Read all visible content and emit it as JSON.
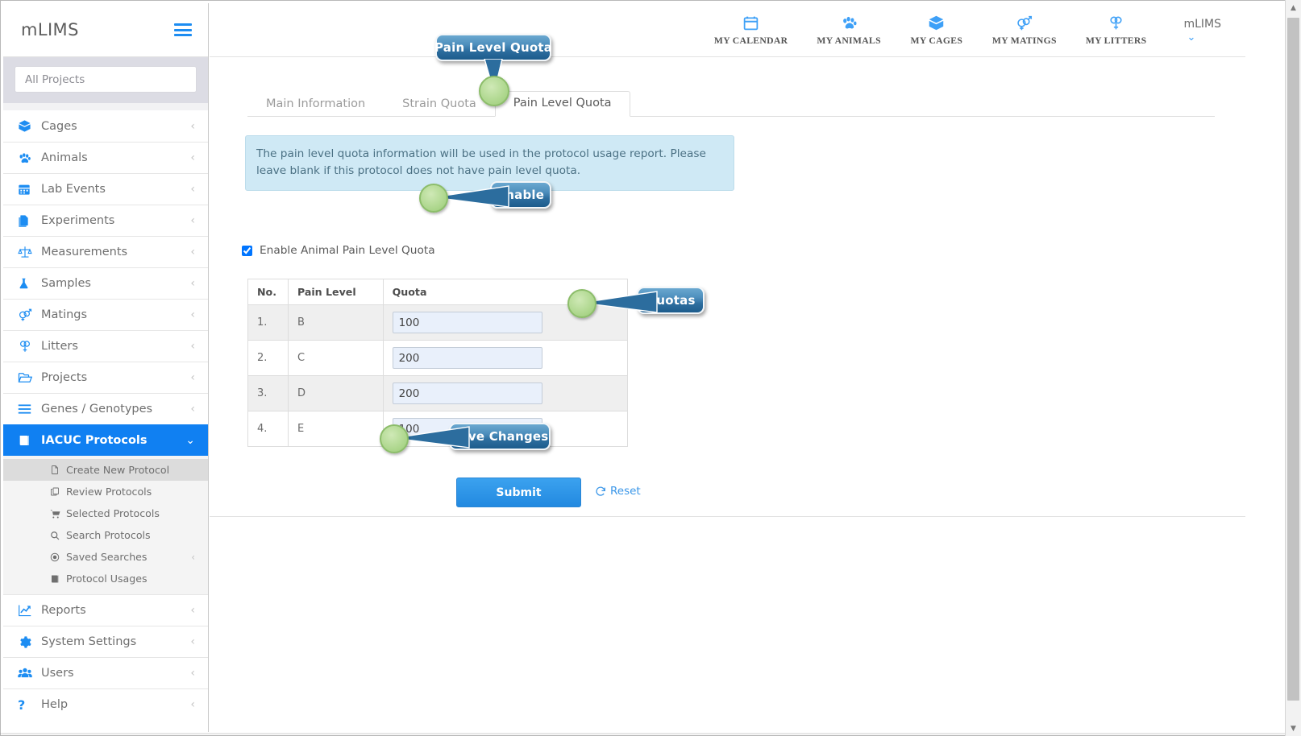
{
  "app": {
    "brand": "mLIMS",
    "menu_icon": "hamburger-icon"
  },
  "sidebar": {
    "project_selector": {
      "placeholder": "All Projects",
      "value": ""
    },
    "items": [
      {
        "label": "Cages",
        "icon": "box-icon",
        "chevron": "‹",
        "active": false
      },
      {
        "label": "Animals",
        "icon": "paw-icon",
        "chevron": "‹",
        "active": false
      },
      {
        "label": "Lab Events",
        "icon": "calendar-icon",
        "chevron": "‹",
        "active": false
      },
      {
        "label": "Experiments",
        "icon": "documents-icon",
        "chevron": "‹",
        "active": false
      },
      {
        "label": "Measurements",
        "icon": "scales-icon",
        "chevron": "‹",
        "active": false
      },
      {
        "label": "Samples",
        "icon": "flask-icon",
        "chevron": "‹",
        "active": false
      },
      {
        "label": "Matings",
        "icon": "mating-icon",
        "chevron": "‹",
        "active": false
      },
      {
        "label": "Litters",
        "icon": "litters-icon",
        "chevron": "‹",
        "active": false
      },
      {
        "label": "Projects",
        "icon": "folder-icon",
        "chevron": "‹",
        "active": false
      },
      {
        "label": "Genes / Genotypes",
        "icon": "list-icon",
        "chevron": "‹",
        "active": false
      },
      {
        "label": "IACUC Protocols",
        "icon": "book-icon",
        "chevron": "⌄",
        "active": true
      }
    ],
    "subitems": [
      {
        "label": "Create New Protocol",
        "icon": "file-icon",
        "selected": true,
        "chevron": ""
      },
      {
        "label": "Review Protocols",
        "icon": "copy-icon",
        "selected": false,
        "chevron": ""
      },
      {
        "label": "Selected Protocols",
        "icon": "cart-icon",
        "selected": false,
        "chevron": ""
      },
      {
        "label": "Search Protocols",
        "icon": "search-icon",
        "selected": false,
        "chevron": ""
      },
      {
        "label": "Saved Searches",
        "icon": "target-icon",
        "selected": false,
        "chevron": "‹"
      },
      {
        "label": "Protocol Usages",
        "icon": "book-icon",
        "selected": false,
        "chevron": ""
      }
    ],
    "items_bottom": [
      {
        "label": "Reports",
        "icon": "chart-icon",
        "chevron": "‹"
      },
      {
        "label": "System Settings",
        "icon": "gear-icon",
        "chevron": "‹"
      },
      {
        "label": "Users",
        "icon": "users-icon",
        "chevron": "‹"
      },
      {
        "label": "Help",
        "icon": "question-icon",
        "chevron": "‹"
      }
    ]
  },
  "topnav": {
    "items": [
      {
        "label": "MY CALENDAR",
        "icon": "calendar-icon"
      },
      {
        "label": "MY ANIMALS",
        "icon": "paw-icon"
      },
      {
        "label": "MY CAGES",
        "icon": "box-icon"
      },
      {
        "label": "MY MATINGS",
        "icon": "mating-icon"
      },
      {
        "label": "MY LITTERS",
        "icon": "litters-icon"
      }
    ],
    "user": {
      "name": "mLIMS",
      "caret": "⌄"
    }
  },
  "main": {
    "tabs": [
      {
        "label": "Main Information",
        "active": false
      },
      {
        "label": "Strain Quota",
        "active": false
      },
      {
        "label": "Pain Level Quota",
        "active": true
      }
    ],
    "info_message": "The pain level quota information will be used in the protocol usage report. Please leave blank if this protocol does not have pain level quota.",
    "enable_checkbox": {
      "label": "Enable Animal Pain Level Quota",
      "checked": true
    },
    "table": {
      "headers": [
        "No.",
        "Pain Level",
        "Quota"
      ],
      "rows": [
        {
          "no": "1.",
          "pain_level": "B",
          "quota": "100"
        },
        {
          "no": "2.",
          "pain_level": "C",
          "quota": "200"
        },
        {
          "no": "3.",
          "pain_level": "D",
          "quota": "200"
        },
        {
          "no": "4.",
          "pain_level": "E",
          "quota": "100"
        }
      ]
    },
    "submit_label": "Submit",
    "reset_label": "Reset"
  },
  "callouts": {
    "pain_level_quota": "Pain Level Quota",
    "enable": "Enable",
    "quotas": "Quotas",
    "save_changes": "Save Changes"
  },
  "colors": {
    "accent_blue": "#1d8df2",
    "active_nav": "#1080f2",
    "info_bg": "#cfe9f5",
    "callout_blue": "#2c6d9e",
    "hotspot_green": "#aad589",
    "input_bg": "#e9f0fb"
  }
}
